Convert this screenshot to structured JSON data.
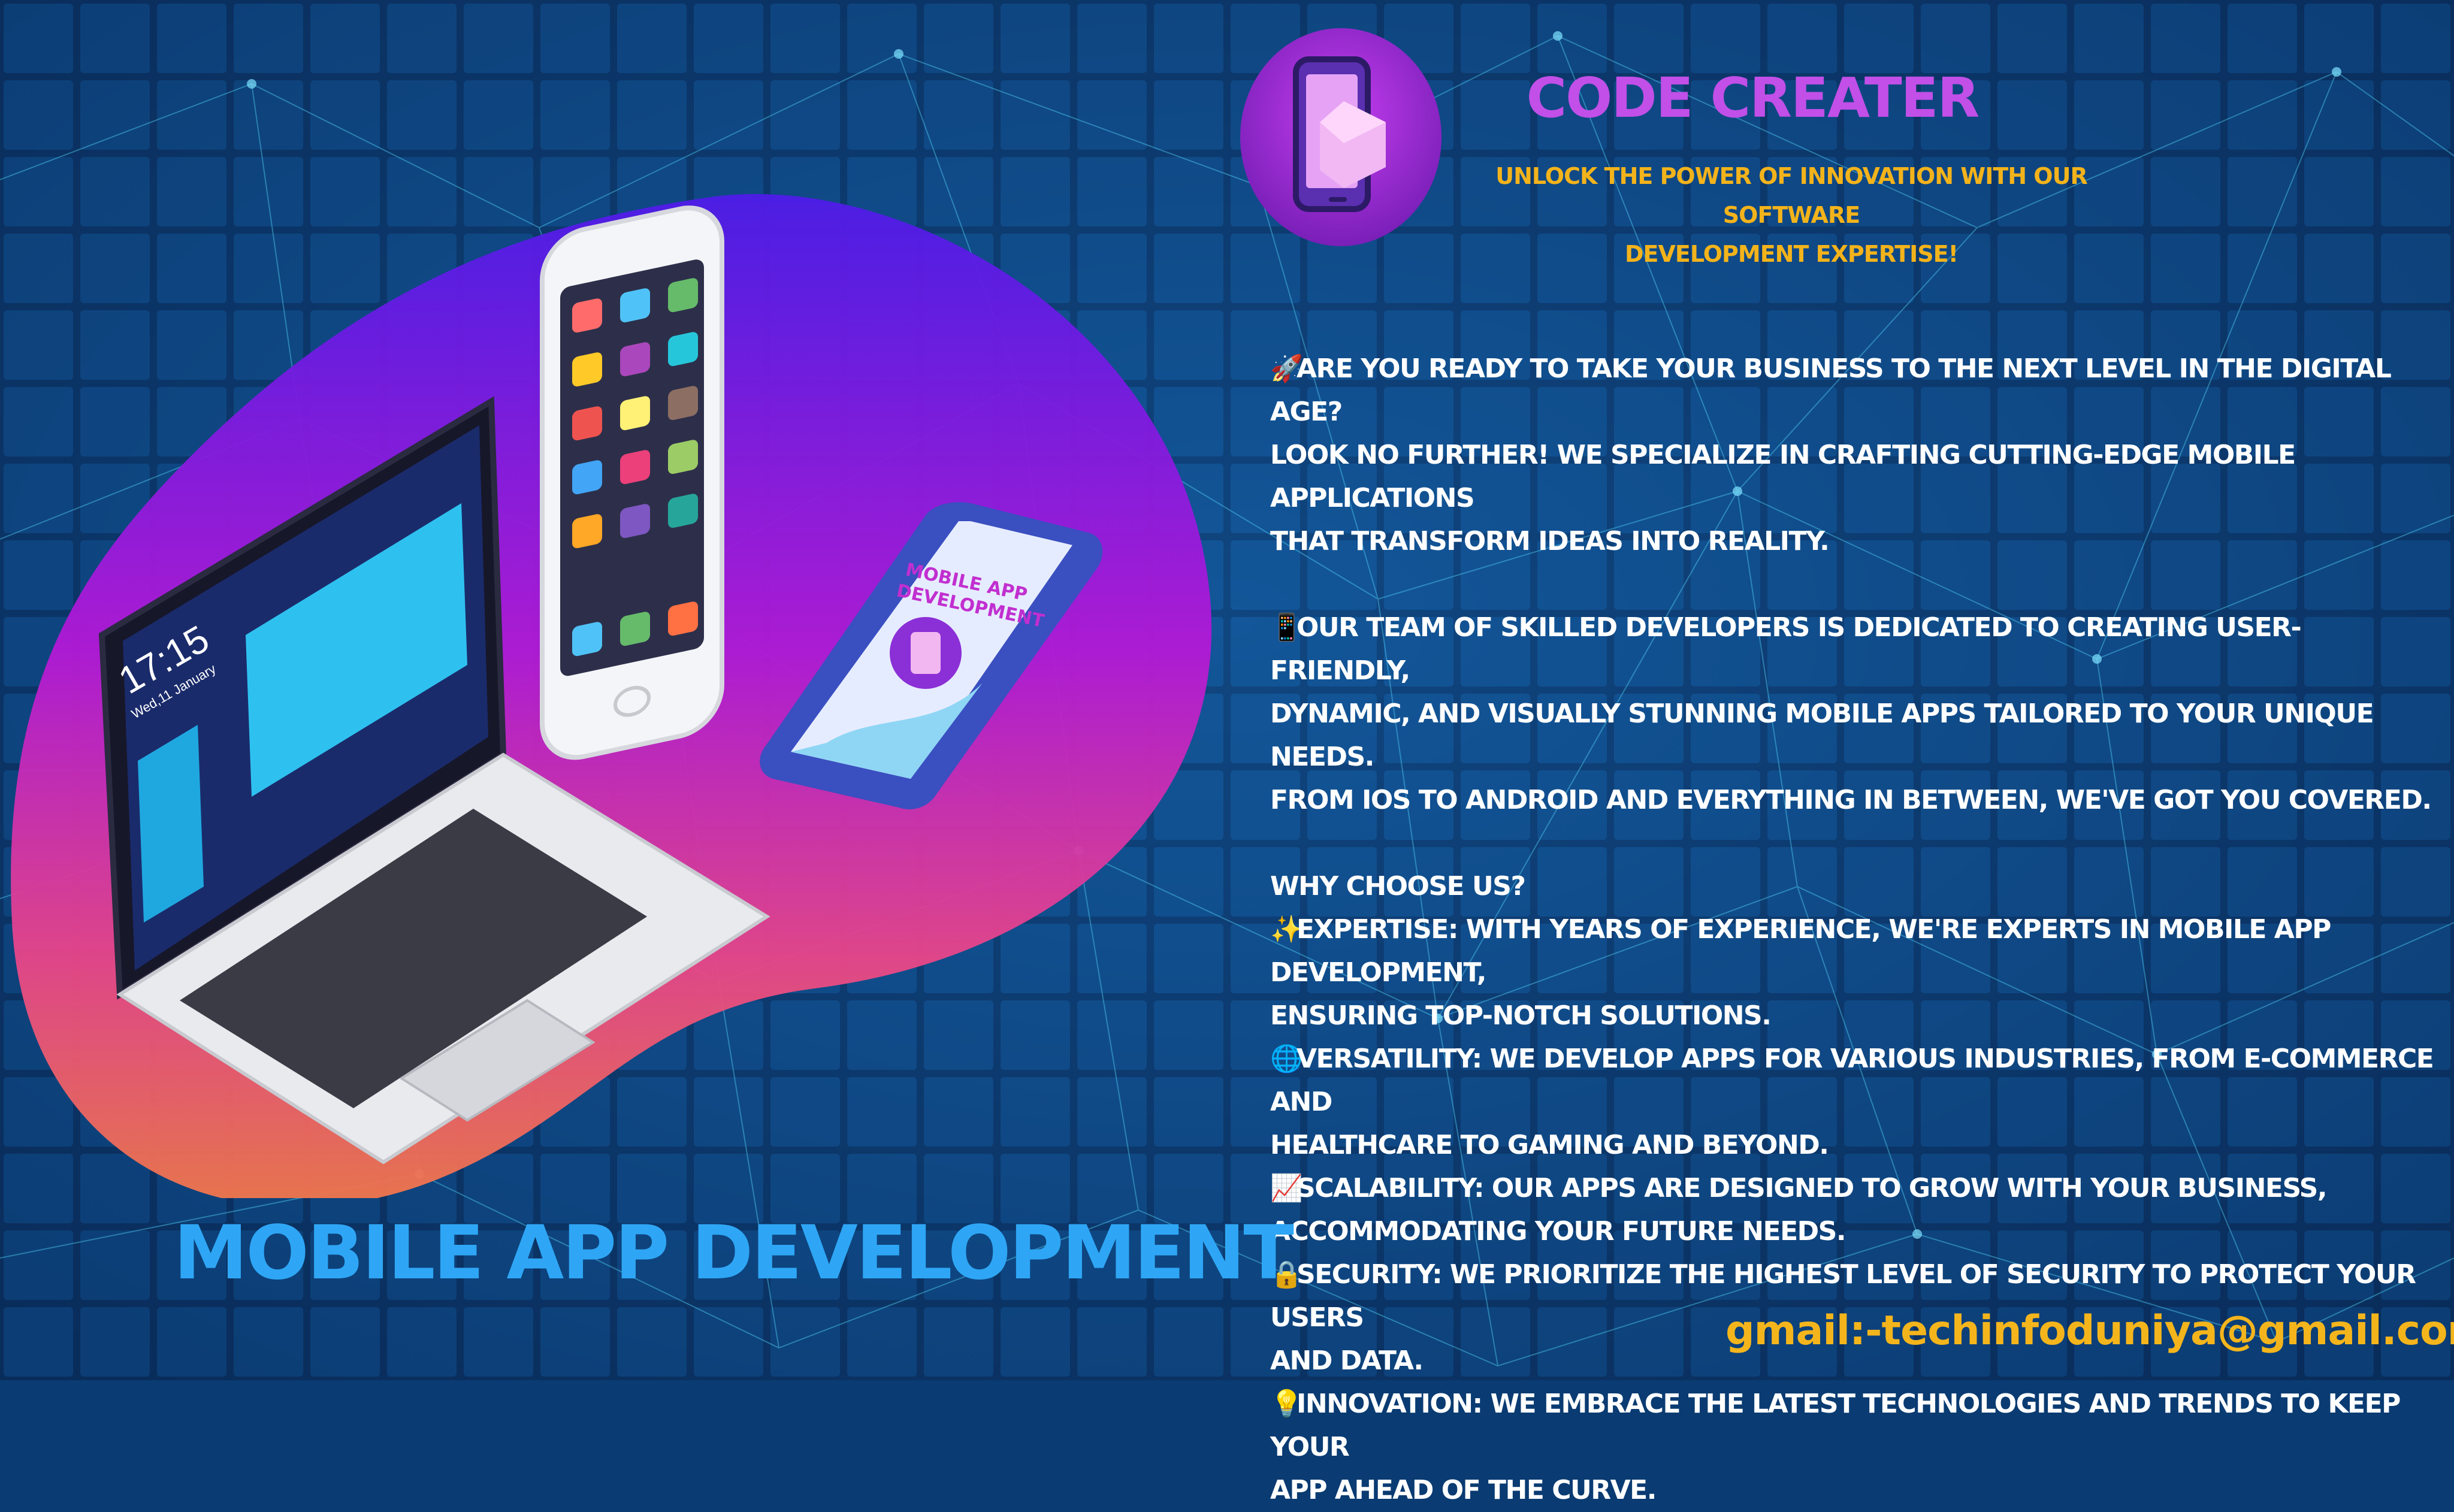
{
  "brand": {
    "name": "CODE CREATER",
    "tagline_line1": "UNLOCK THE POWER OF INNOVATION WITH OUR SOFTWARE",
    "tagline_line2": "DEVELOPMENT EXPERTISE!"
  },
  "intro": {
    "icon": "rocket-icon",
    "line1": "ARE YOU READY TO TAKE YOUR BUSINESS TO THE NEXT LEVEL IN THE DIGITAL AGE?",
    "line2": "LOOK NO FURTHER! WE SPECIALIZE IN CRAFTING CUTTING-EDGE MOBILE APPLICATIONS",
    "line3": "THAT TRANSFORM IDEAS INTO REALITY."
  },
  "team": {
    "icon": "mobile-phone-icon",
    "line1": "OUR TEAM OF SKILLED DEVELOPERS IS DEDICATED TO CREATING USER-FRIENDLY,",
    "line2": "DYNAMIC, AND VISUALLY STUNNING MOBILE APPS TAILORED TO YOUR UNIQUE NEEDS.",
    "line3": "FROM IOS TO ANDROID AND EVERYTHING IN BETWEEN, WE'VE GOT YOU COVERED."
  },
  "why": {
    "heading": "WHY CHOOSE US?",
    "items": [
      {
        "icon": "sparkles-icon",
        "line1": "EXPERTISE: WITH YEARS OF EXPERIENCE, WE'RE EXPERTS IN MOBILE APP DEVELOPMENT,",
        "line2": "ENSURING TOP-NOTCH SOLUTIONS."
      },
      {
        "icon": "globe-icon",
        "line1": "VERSATILITY: WE DEVELOP APPS FOR VARIOUS INDUSTRIES, FROM E-COMMERCE AND",
        "line2": "HEALTHCARE TO GAMING AND BEYOND."
      },
      {
        "icon": "chart-increasing-icon",
        "line1": "SCALABILITY: OUR APPS ARE DESIGNED TO GROW WITH YOUR BUSINESS,",
        "line2": "ACCOMMODATING YOUR FUTURE NEEDS."
      },
      {
        "icon": "lock-icon",
        "line1": "SECURITY: WE PRIORITIZE THE HIGHEST LEVEL OF SECURITY TO PROTECT YOUR USERS",
        "line2": "AND DATA."
      },
      {
        "icon": "light-bulb-icon",
        "line1": "INNOVATION: WE EMBRACE THE LATEST TECHNOLOGIES AND TRENDS TO KEEP YOUR",
        "line2": "APP AHEAD OF THE CURVE."
      }
    ]
  },
  "illustration": {
    "laptop_time": "17:15",
    "laptop_date": "Wed,11 January",
    "phone_label_line1": "MOBILE APP",
    "phone_label_line2": "DEVELOPMENT"
  },
  "footer": {
    "title": "MOBILE APP DEVELOPMENT",
    "email": "gmail:-techinfoduniya@gmail.com"
  },
  "colors": {
    "background": "#0a3b72",
    "brand": "#c14fe8",
    "tagline": "#f3b31b",
    "footer_title": "#2ea6f5",
    "email": "#f4b51c"
  }
}
